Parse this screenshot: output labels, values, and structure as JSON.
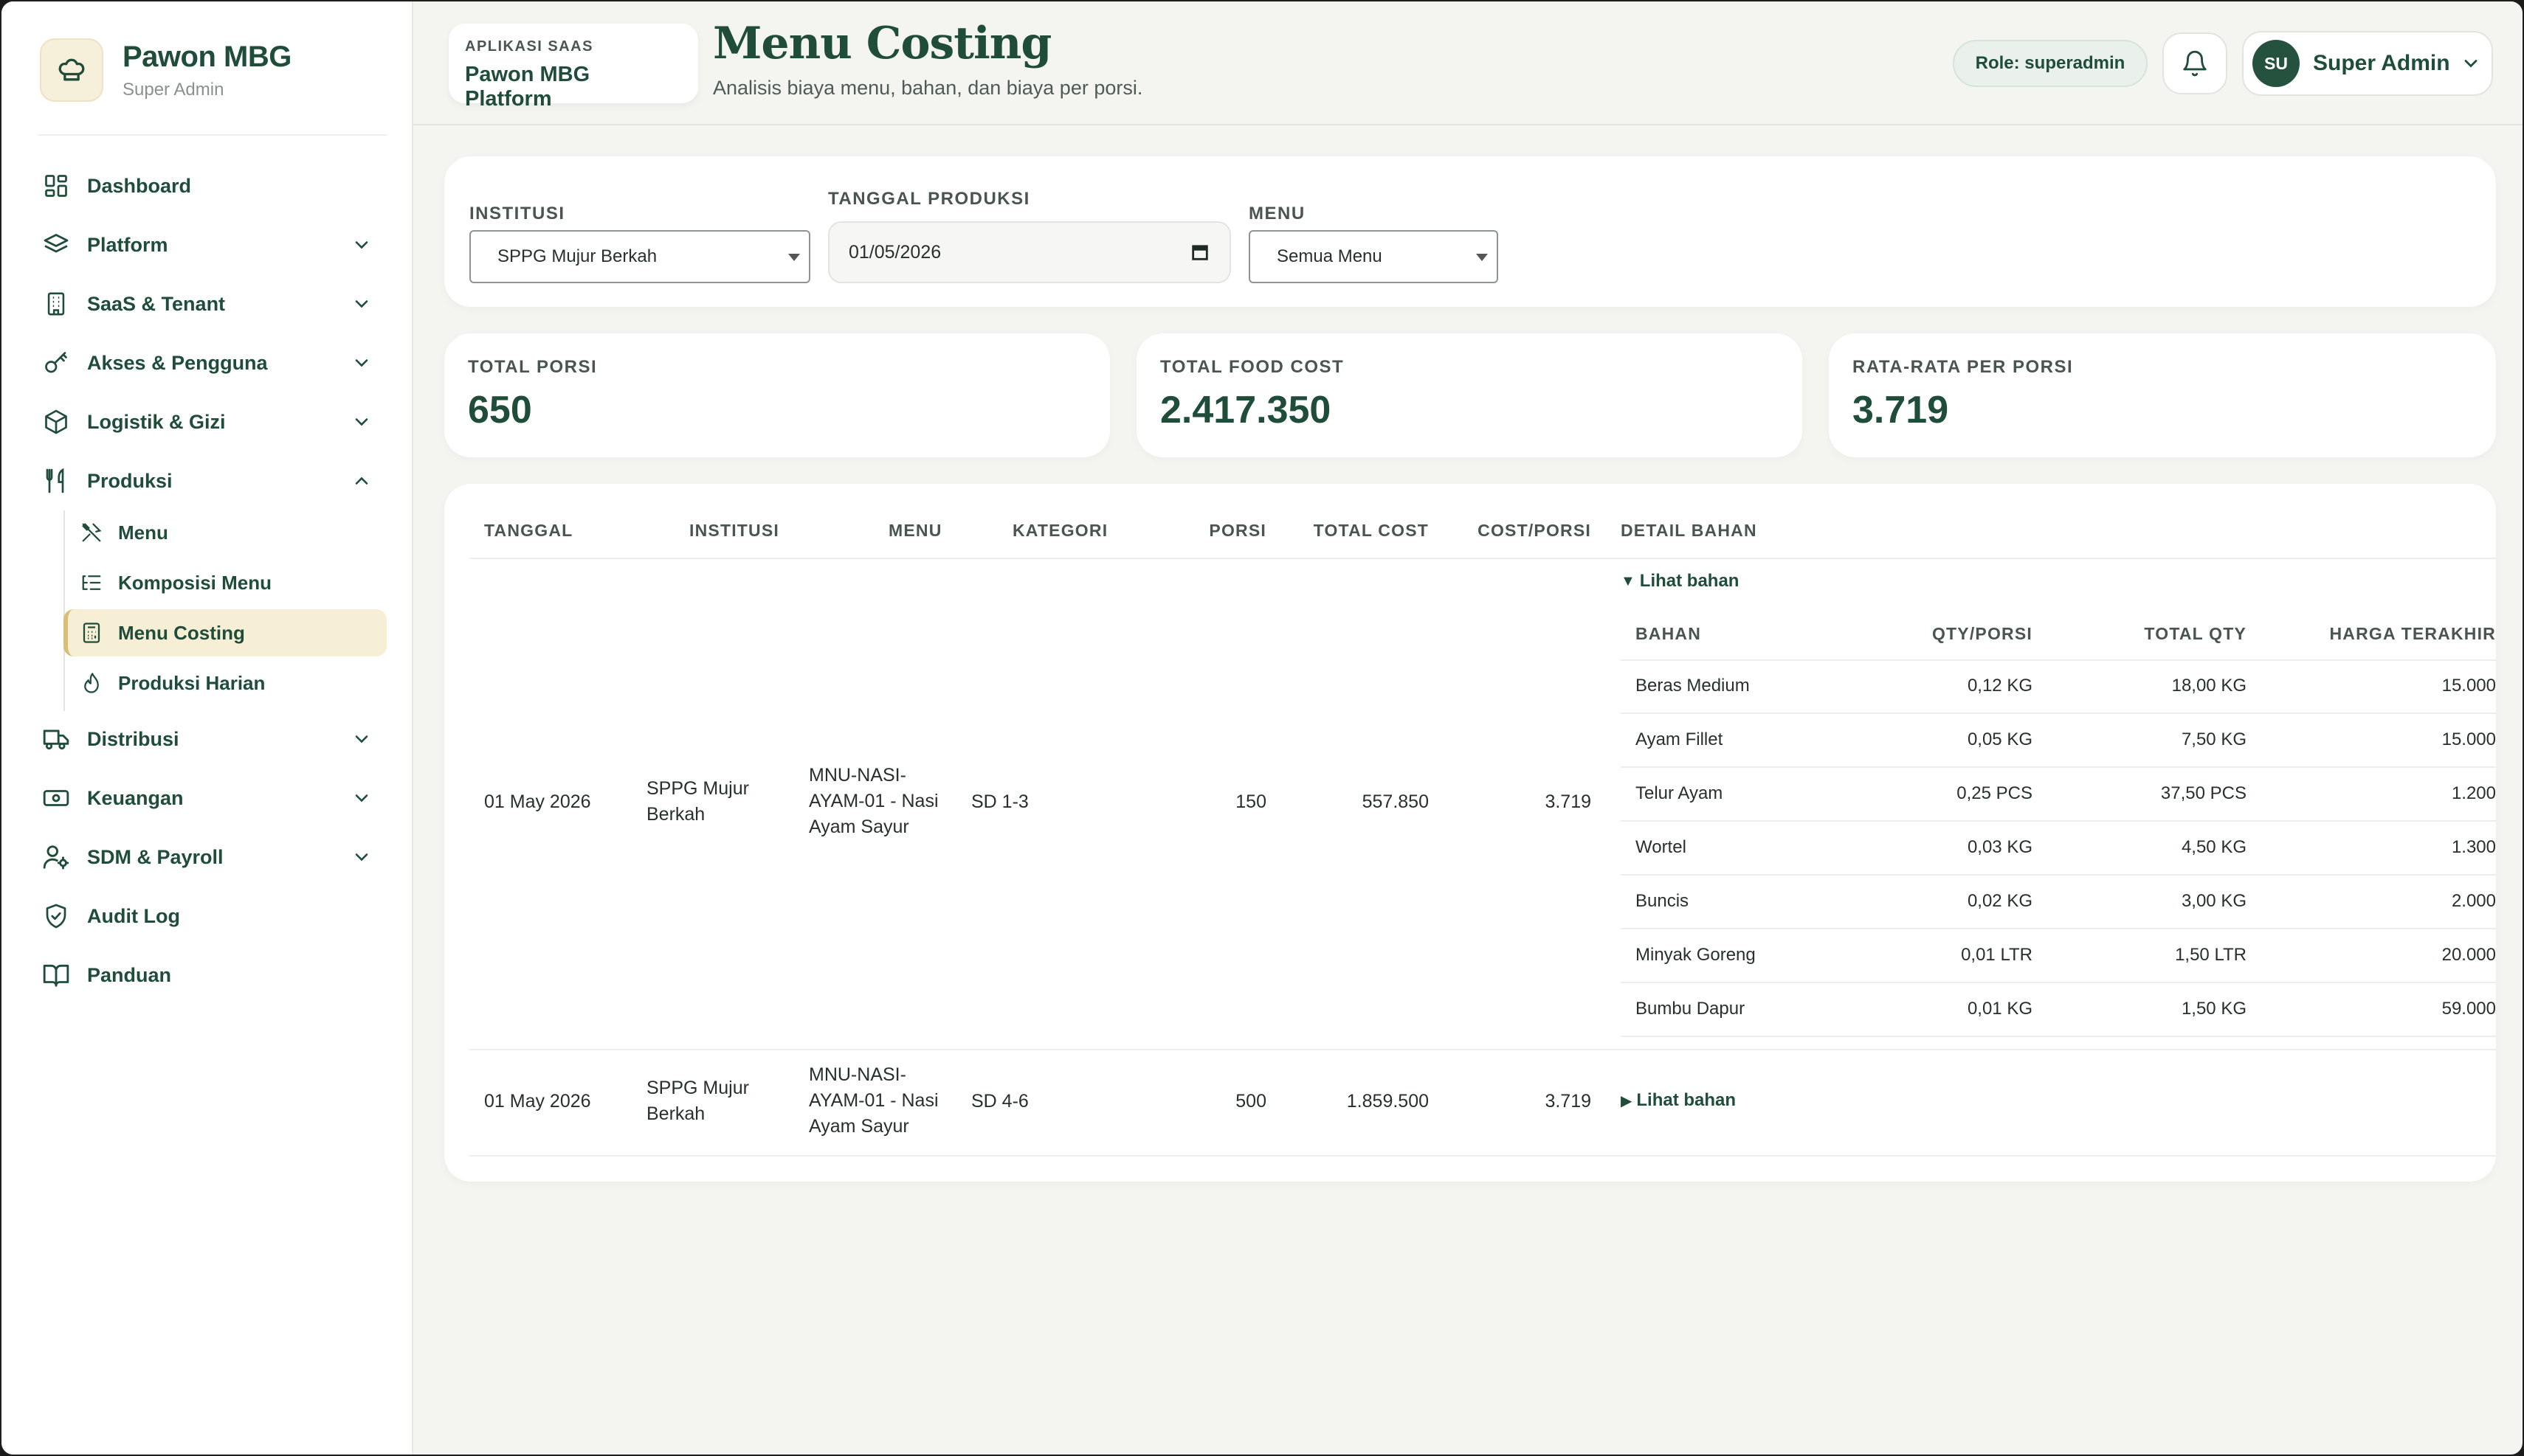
{
  "sidebar": {
    "brand_name": "Pawon MBG",
    "brand_role": "Super Admin",
    "items": [
      {
        "label": "Dashboard"
      },
      {
        "label": "Platform"
      },
      {
        "label": "SaaS & Tenant"
      },
      {
        "label": "Akses & Pengguna"
      },
      {
        "label": "Logistik & Gizi"
      },
      {
        "label": "Produksi"
      },
      {
        "label": "Distribusi"
      },
      {
        "label": "Keuangan"
      },
      {
        "label": "SDM & Payroll"
      },
      {
        "label": "Audit Log"
      },
      {
        "label": "Panduan"
      }
    ],
    "produksi_sub": [
      {
        "label": "Menu"
      },
      {
        "label": "Komposisi Menu"
      },
      {
        "label": "Menu Costing",
        "active": true
      },
      {
        "label": "Produksi Harian"
      }
    ]
  },
  "header": {
    "app_kicker": "APLIKASI SAAS",
    "app_name": "Pawon MBG Platform",
    "title": "Menu Costing",
    "subtitle": "Analisis biaya menu, bahan, dan biaya per porsi.",
    "role": "Role: superadmin",
    "user_initials": "SU",
    "user_name": "Super Admin"
  },
  "filters": {
    "institusi_label": "INSTITUSI",
    "institusi_value": "SPPG Mujur Berkah",
    "tanggal_label": "TANGGAL PRODUKSI",
    "tanggal_value": "01/05/2026",
    "menu_label": "MENU",
    "menu_value": "Semua Menu"
  },
  "stats": [
    {
      "label": "TOTAL PORSI",
      "value": "650"
    },
    {
      "label": "TOTAL FOOD COST",
      "value": "2.417.350"
    },
    {
      "label": "RATA-RATA PER PORSI",
      "value": "3.719"
    }
  ],
  "table": {
    "columns": [
      "TANGGAL",
      "INSTITUSI",
      "MENU",
      "KATEGORI",
      "PORSI",
      "TOTAL COST",
      "COST/PORSI",
      "DETAIL BAHAN"
    ],
    "rows": [
      {
        "tanggal": "01 May 2026",
        "institusi_l1": "SPPG Mujur",
        "institusi_l2": "Berkah",
        "menu_l1": "MNU-NASI-",
        "menu_l2": "AYAM-01 - Nasi",
        "menu_l3": "Ayam Sayur",
        "kategori": "SD 1-3",
        "porsi": "150",
        "total_cost": "557.850",
        "cost_porsi": "3.719",
        "detail_toggle": "Lihat bahan"
      },
      {
        "tanggal": "01 May 2026",
        "institusi_l1": "SPPG Mujur",
        "institusi_l2": "Berkah",
        "menu_l1": "MNU-NASI-",
        "menu_l2": "AYAM-01 - Nasi",
        "menu_l3": "Ayam Sayur",
        "kategori": "SD 4-6",
        "porsi": "500",
        "total_cost": "1.859.500",
        "cost_porsi": "3.719",
        "detail_toggle": "Lihat bahan"
      }
    ],
    "detail_columns": [
      "BAHAN",
      "QTY/PORSI",
      "TOTAL QTY",
      "HARGA TERAKHIR"
    ],
    "detail_rows": [
      {
        "bahan": "Beras Medium",
        "qty": "0,12 KG",
        "total": "18,00 KG",
        "harga": "15.000"
      },
      {
        "bahan": "Ayam Fillet",
        "qty": "0,05 KG",
        "total": "7,50 KG",
        "harga": "15.000"
      },
      {
        "bahan": "Telur Ayam",
        "qty": "0,25 PCS",
        "total": "37,50 PCS",
        "harga": "1.200"
      },
      {
        "bahan": "Wortel",
        "qty": "0,03 KG",
        "total": "4,50 KG",
        "harga": "1.300"
      },
      {
        "bahan": "Buncis",
        "qty": "0,02 KG",
        "total": "3,00 KG",
        "harga": "2.000"
      },
      {
        "bahan": "Minyak Goreng",
        "qty": "0,01 LTR",
        "total": "1,50 LTR",
        "harga": "20.000"
      },
      {
        "bahan": "Bumbu Dapur",
        "qty": "0,01 KG",
        "total": "1,50 KG",
        "harga": "59.000"
      }
    ]
  }
}
